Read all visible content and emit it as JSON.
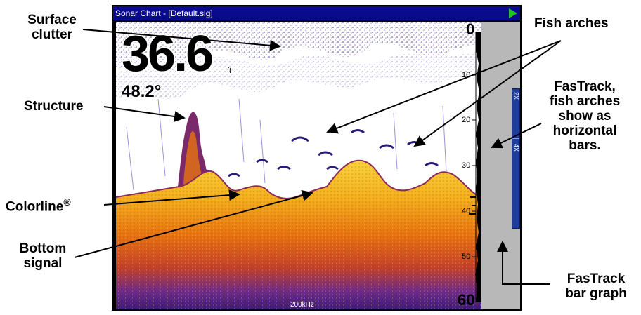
{
  "window": {
    "title": "Sonar Chart - [Default.slg]"
  },
  "readouts": {
    "depth": "36.6",
    "depth_unit": "ft",
    "temperature": "48.2°",
    "frequency": "200kHz"
  },
  "depth_scale": {
    "top": "0",
    "bottom": "60",
    "ticks": [
      "10",
      "20",
      "30",
      "40",
      "50"
    ]
  },
  "zoom": {
    "levels": [
      "2X",
      "4X"
    ]
  },
  "callouts": {
    "surface_clutter": [
      "Surface",
      "clutter"
    ],
    "structure": "Structure",
    "colorline": "Colorline",
    "colorline_mark": "®",
    "bottom_signal": [
      "Bottom",
      "signal"
    ],
    "fish_arches": "Fish arches",
    "fastrack": [
      "FasTrack,",
      "fish arches",
      "show as",
      "horizontal",
      "bars."
    ],
    "fastrack_bar_graph": [
      "FasTrack",
      "bar graph"
    ]
  },
  "colors": {
    "title_bar": "#0a0a8c",
    "play_icon": "#22c322",
    "bottom_yellow": "#f5c71a",
    "bottom_orange": "#e8730f",
    "bottom_purple": "#5a2a9a",
    "clutter_blue": "#2a2ab8",
    "sidebar_gray": "#b8b8b8",
    "zoom_blue": "#1d3c9c"
  }
}
